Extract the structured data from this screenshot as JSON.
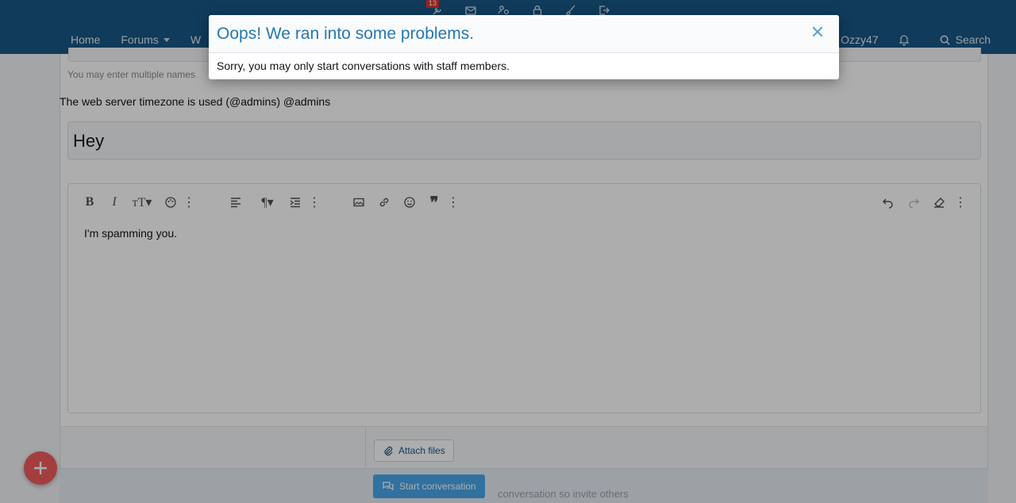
{
  "header": {
    "alert_count": "13",
    "nav": [
      {
        "label": "Home"
      },
      {
        "label": "Forums"
      },
      {
        "label": "W"
      }
    ],
    "username": "Ozzy47",
    "search_label": "Search"
  },
  "form": {
    "recipients_hint": "You may enter multiple names",
    "timezone_note": "The web server timezone is used (@admins) @admins",
    "title_value": "Hey",
    "message_value": "I'm spamming you.",
    "attach_label": "Attach files",
    "submit_label": "Start conversation",
    "behind_text": "conversation so invite others"
  },
  "modal": {
    "title": "Oops! We ran into some problems.",
    "close_glyph": "✕",
    "message": "Sorry, you may only start conversations with staff members."
  },
  "colors": {
    "header": "#185886",
    "modal_title": "#2577b1",
    "primary_button": "#47a7eb",
    "fab": "#f25c5c",
    "badge": "#e03030"
  },
  "icons": [
    "wrench-icon",
    "envelope-icon",
    "users-cog-icon",
    "lock-icon",
    "brush-icon",
    "sign-out-icon",
    "bell-icon",
    "search-icon",
    "paperclip-icon",
    "comments-icon",
    "plus-icon"
  ]
}
